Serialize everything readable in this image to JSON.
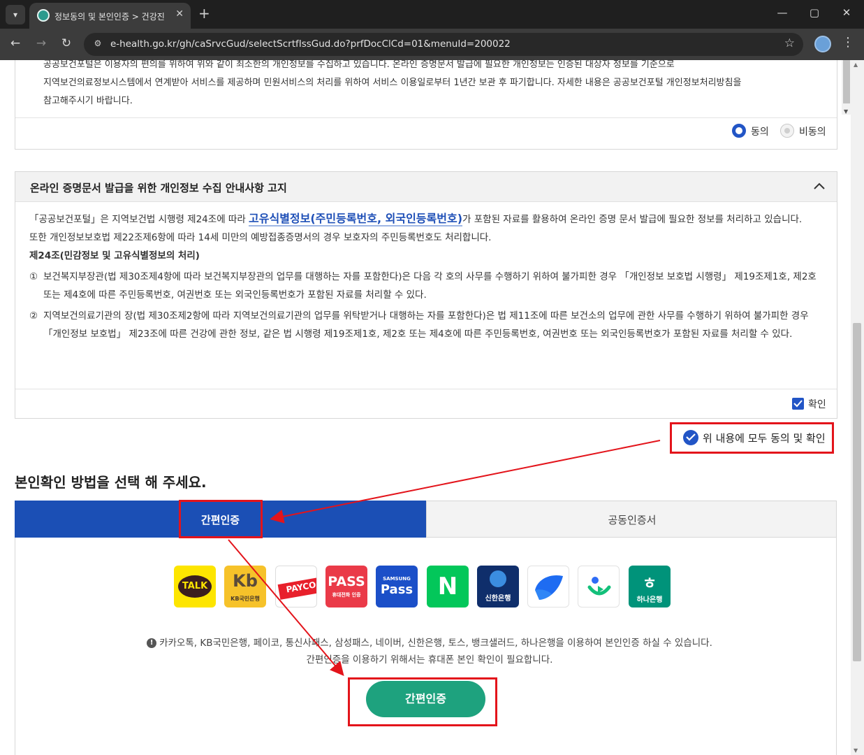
{
  "browser": {
    "tab_title": "정보동의 및 본인인증 > 건강진",
    "url": "e-health.go.kr/gh/caSrvcGud/selectScrtfIssGud.do?prfDocClCd=01&menuId=200022",
    "new_tab_label": "+",
    "close_label": "✕",
    "back_label": "←",
    "forward_label": "→",
    "reload_label": "↻",
    "star_label": "☆",
    "menu_label": "⋮"
  },
  "privacy_box": {
    "lines": [
      "공공보건포털은 이용자의 편의를 위하여 위와 같이 최소한의 개인정보를 수집하고 있습니다. 온라인 증명문서 발급에 필요한 개인정보는 인증된 대상자 정보를 기준으로",
      "지역보건의료정보시스템에서 연계받아 서비스를 제공하며 민원서비스의 처리를 위하여 서비스 이용일로부터 1년간 보관 후 파기합니다. 자세한 내용은 공공보건포털 개인정보처리방침을",
      "참고해주시기 바랍니다."
    ],
    "agree_label": "동의",
    "disagree_label": "비동의"
  },
  "notice_box": {
    "title": "온라인 증명문서 발급을 위한 개인정보 수집 안내사항 고지",
    "line1_prefix": "「공공보건포털」은 지역보건법 시행령 제24조에 따라 ",
    "line1_highlight": "고유식별정보(주민등록번호, 외국인등록번호)",
    "line1_suffix": "가 포함된 자료를 활용하여 온라인 증명 문서 발급에 필요한 정보를 처리하고 있습니다.",
    "line2": "또한 개인정보보호법 제22조제6항에 따라 14세 미만의 예방접종증명서의 경우 보호자의 주민등록번호도 처리합니다.",
    "article_title": "제24조(민감정보 및 고유식별정보의 처리)",
    "items": [
      {
        "num": "①",
        "line1": "보건복지부장관(법 제30조제4항에 따라 보건복지부장관의 업무를 대행하는 자를 포함한다)은 다음 각 호의 사무를 수행하기 위하여 불가피한 경우 「개인정보 보호법 시행령」 제19조제1호, 제2호",
        "line2": "또는 제4호에 따른 주민등록번호, 여권번호 또는 외국인등록번호가 포함된 자료를 처리할 수 있다."
      },
      {
        "num": "②",
        "line1": "지역보건의료기관의 장(법 제30조제2항에 따라 지역보건의료기관의 업무를 위탁받거나 대행하는 자를 포함한다)은 법 제11조에 따른 보건소의 업무에 관한 사무를 수행하기 위하여 불가피한 경우",
        "line2": "「개인정보 보호법」 제23조에 따른 건강에 관한 정보, 같은 법 시행령 제19조제1호, 제2호 또는 제4호에 따른 주민등록번호, 여권번호 또는 외국인등록번호가 포함된 자료를 처리할 수 있다."
      }
    ],
    "confirm_label": "확인"
  },
  "agree_all_label": "위 내용에 모두 동의 및 확인",
  "section_title": "본인확인 방법을 선택 해 주세요.",
  "auth_tabs": [
    "간편인증",
    "공동인증서"
  ],
  "providers": [
    {
      "name": "kakao",
      "label": "TALK"
    },
    {
      "name": "kb",
      "label": "KB국민은행"
    },
    {
      "name": "payco",
      "label": "PAYCO"
    },
    {
      "name": "pass",
      "label": "PASS",
      "sub": "휴대전화 인증"
    },
    {
      "name": "samsung",
      "label": "Pass",
      "sub": "SAMSUNG"
    },
    {
      "name": "naver",
      "label": "N"
    },
    {
      "name": "shinhan",
      "label": "신한은행"
    },
    {
      "name": "toss",
      "label": ""
    },
    {
      "name": "banksalad",
      "label": ""
    },
    {
      "name": "hana",
      "label": "하나은행"
    }
  ],
  "notice_text": {
    "line1": "카카오톡, KB국민은행, 페이코, 통신사패스, 삼성패스, 네이버, 신한은행, 토스, 뱅크샐러드, 하나은행을 이용하여 본인인증 하실 수 있습니다.",
    "line2": "간편인증을 이용하기 위해서는 휴대폰 본인 확인이 필요합니다."
  },
  "submit_label": "간편인증",
  "colors": {
    "primary_blue": "#1b4fb5",
    "green_button": "#1ea27e",
    "annotation_red": "#e3141b"
  }
}
